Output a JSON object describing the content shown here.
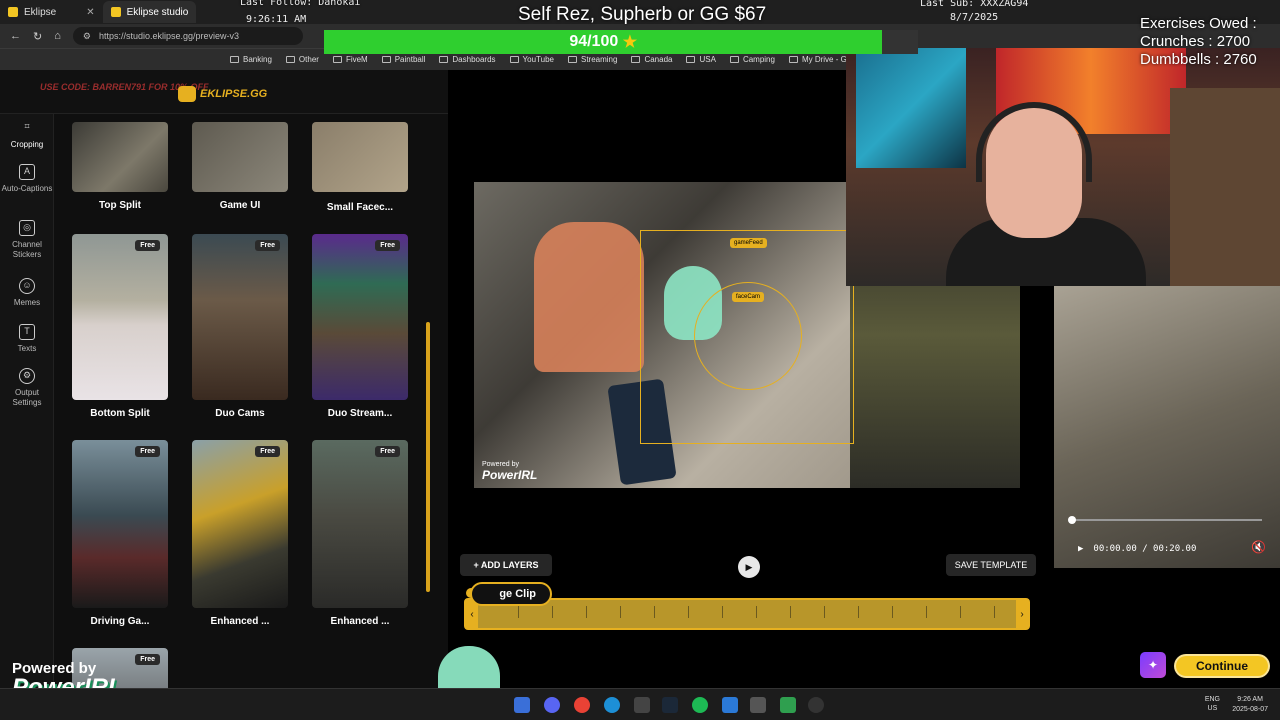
{
  "browser": {
    "tabs": [
      {
        "label": "Eklipse"
      },
      {
        "label": "Eklipse studio"
      }
    ],
    "url": "https://studio.eklipse.gg/preview-v3",
    "bookmarks": [
      "Banking",
      "Other",
      "FiveM",
      "Paintball",
      "Dashboards",
      "YouTube",
      "Streaming",
      "Canada",
      "USA",
      "Camping",
      "My Drive - Googl"
    ]
  },
  "overlay": {
    "last_follow": "Last Follow: Danokai",
    "time": "9:26:11 AM",
    "goal_text": "Self Rez, Supherb or GG $67",
    "last_sub": "Last Sub: XXXZAG94",
    "date": "8/7/2025",
    "exercises_title": "Exercises Owed :",
    "crunches": "Crunches : 2700",
    "dumbbells": "Dumbbells : 2760",
    "progress_label": "94/100",
    "progress_value": 94,
    "progress_max": 100,
    "powered_by": "Powered by",
    "powerirl": "PowerIRL"
  },
  "app": {
    "promo": "USE CODE: BARREN791 FOR 10% OFF",
    "logo": "EKLIPSE.GG",
    "nav": [
      {
        "label": "Cropping"
      },
      {
        "label": "Auto-Captions"
      },
      {
        "label": "Channel Stickers"
      },
      {
        "label": "Memes"
      },
      {
        "label": "Texts"
      },
      {
        "label": "Output Settings"
      }
    ],
    "templates": [
      {
        "label": "Top Split",
        "badge": ""
      },
      {
        "label": "Game UI",
        "badge": ""
      },
      {
        "label": "Small Facec...",
        "badge": ""
      },
      {
        "label": "Bottom Split",
        "badge": "Free"
      },
      {
        "label": "Duo Cams",
        "badge": "Free"
      },
      {
        "label": "Duo Stream...",
        "badge": "Free"
      },
      {
        "label": "Driving Ga...",
        "badge": "Free"
      },
      {
        "label": "Enhanced ...",
        "badge": "Free"
      },
      {
        "label": "Enhanced ...",
        "badge": "Free"
      },
      {
        "label": "",
        "badge": "Free"
      }
    ],
    "preview_tags": {
      "gamefeed": "gameFeed",
      "facecam": "faceCam"
    },
    "preview_powered": "Powered by",
    "preview_powerirl": "PowerIRL",
    "video_time": "00:00.00 / 00:20.00",
    "add_layers": "+ ADD LAYERS",
    "save_template": "SAVE TEMPLATE",
    "change_clip": "ge Clip",
    "continue": "Continue"
  },
  "taskbar": {
    "lang": "ENG",
    "region": "US",
    "time": "9:26 AM",
    "date": "2025-08-07"
  },
  "colors": {
    "accent": "#f3c623",
    "progress": "#2fcf2f",
    "bg": "#0f0f0f"
  }
}
